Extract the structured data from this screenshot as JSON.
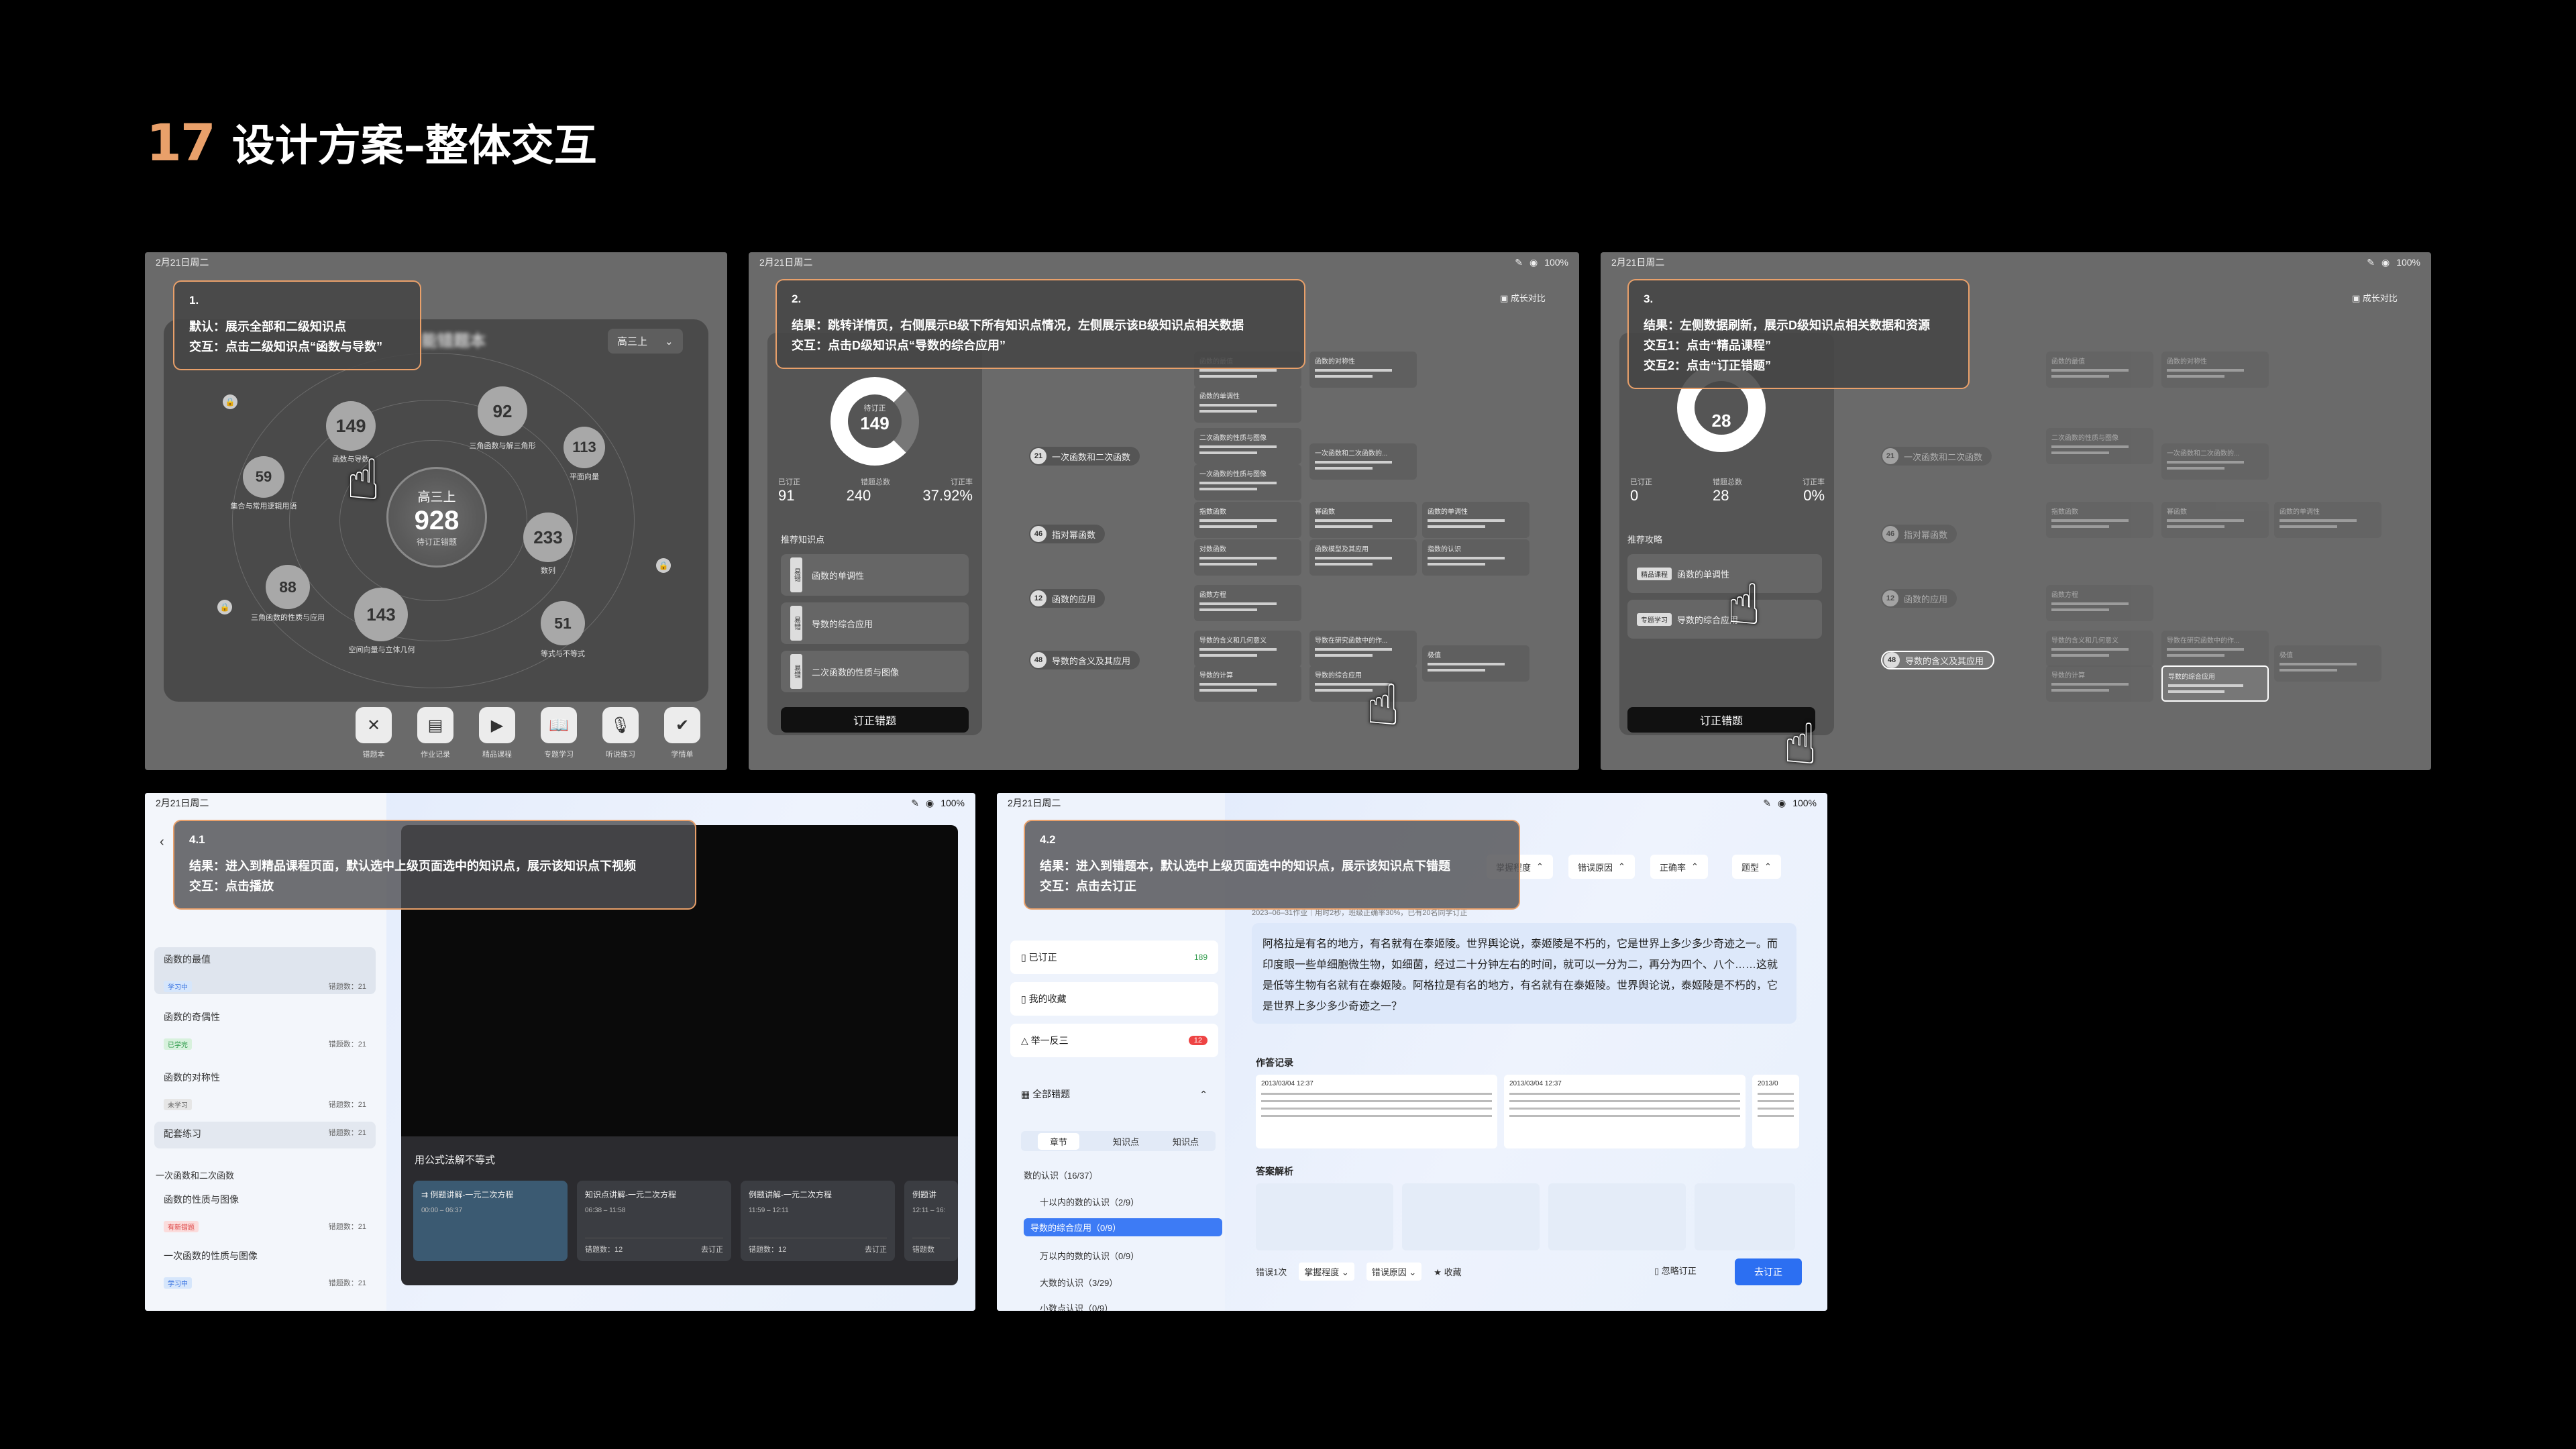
{
  "page": {
    "num": "17",
    "title": "设计方案–整体交互"
  },
  "status": {
    "date": "2月21日周二",
    "battery": "100%"
  },
  "common": {
    "contrast": "成长对比",
    "correct_btn": "订正错题"
  },
  "s1": {
    "note_num": "1.",
    "note_l1": "默认：展示全部和二级知识点",
    "note_l2": "交互：点击二级知识点“函数与导数”",
    "app_title": "能错题本",
    "grade_select": "高三上",
    "center": {
      "grade": "高三上",
      "value": "928",
      "sub": "待订正错题"
    },
    "bubbles": [
      {
        "v": "149",
        "l": "函数与导数"
      },
      {
        "v": "92",
        "l": "三角函数与解三角形"
      },
      {
        "v": "113",
        "l": "平面向量"
      },
      {
        "v": "59",
        "l": "集合与常用逻辑用语"
      },
      {
        "v": "233",
        "l": "数列"
      },
      {
        "v": "88",
        "l": "三角函数的性质与应用"
      },
      {
        "v": "143",
        "l": "空间向量与立体几何"
      },
      {
        "v": "51",
        "l": "等式与不等式"
      }
    ],
    "tools": [
      {
        "i": "✕",
        "l": "错题本"
      },
      {
        "i": "▤",
        "l": "作业记录"
      },
      {
        "i": "▶",
        "l": "精品课程"
      },
      {
        "i": "📖",
        "l": "专题学习"
      },
      {
        "i": "🎙",
        "l": "听说练习"
      },
      {
        "i": "✔",
        "l": "学情单"
      }
    ]
  },
  "s2": {
    "note_num": "2.",
    "note_l1": "结果：跳转详情页，右侧展示B级下所有知识点情况，左侧展示该B级知识点相关数据",
    "note_l2": "交互：点击D级知识点“导数的综合应用”",
    "ring": {
      "top": "待订正",
      "value": "149"
    },
    "stats": [
      "91",
      "240",
      "37.92%"
    ],
    "stat_labels": [
      "已订正",
      "错题总数",
      "订正率"
    ],
    "rec_label": "推荐知识点",
    "recs": [
      "函数的单调性",
      "导数的综合应用",
      "二次函数的性质与图像"
    ],
    "nodes": [
      {
        "b": "21",
        "l": "一次函数和二次函数"
      },
      {
        "b": "46",
        "l": "指对幂函数"
      },
      {
        "b": "12",
        "l": "函数的应用"
      },
      {
        "b": "48",
        "l": "导数的含义及其应用"
      }
    ],
    "leaves": [
      "函数的最值",
      "函数的对称性",
      "函数的单调性",
      "二次函数的性质与图像",
      "一次函数的性质与图像",
      "一次函数和二次函数的...",
      "指数函数",
      "幂函数",
      "函数的单调性",
      "对数函数",
      "函数模型及其应用",
      "指数的认识",
      "函数方程",
      "导数的含义和几何意义",
      "导数在研究函数中的作...",
      "导数的计算",
      "导数的综合应用",
      "极值"
    ]
  },
  "s3": {
    "note_num": "3.",
    "note_l1": "结果：左侧数据刷新，展示D级知识点相关数据和资源",
    "note_l2": "交互1：点击“精品课程”",
    "note_l3": "交互2：点击“订正错题”",
    "ring": {
      "value": "28"
    },
    "stats": [
      "0",
      "28",
      "0%"
    ],
    "stat_labels": [
      "已订正",
      "错题总数",
      "订正率"
    ],
    "rec_label": "推荐攻略",
    "recs": [
      {
        "tag": "精品课程",
        "l": "函数的单调性"
      },
      {
        "tag": "专题学习",
        "l": "导数的综合应用"
      }
    ],
    "selected_node": "导数的含义及其应用",
    "selected_leaf": "导数的综合应用"
  },
  "s41": {
    "note_num": "4.1",
    "note_l1": "结果：进入到精品课程页面，默认选中上级页面选中的知识点，展示该知识点下视频",
    "note_l2": "交互：点击播放",
    "items": [
      {
        "l": "函数的最值",
        "t": "学习中",
        "c": "错题数：21"
      },
      {
        "l": "函数的奇偶性",
        "t": "已学完",
        "c": "错题数：21"
      },
      {
        "l": "函数的对称性",
        "t": "未学习",
        "c": "错题数：21"
      }
    ],
    "practice": {
      "l": "配套练习",
      "c": "错题数：21"
    },
    "chapter": "一次函数和二次函数",
    "items2": [
      {
        "l": "函数的性质与图像",
        "t": "有新错题",
        "c": "错题数：21"
      },
      {
        "l": "一次函数的性质与图像",
        "t": "学习中",
        "c": "错题数：21"
      }
    ],
    "video_title": "用公式法解不等式",
    "cards": [
      {
        "t": "例题讲解-一元二次方程",
        "tm": "00:00 – 06:37",
        "c": "",
        "a": ""
      },
      {
        "t": "知识点讲解-一元二次方程",
        "tm": "06:38 – 11:58",
        "c": "错题数：12",
        "a": "去订正"
      },
      {
        "t": "例题讲解-一元二次方程",
        "tm": "11:59 – 12:11",
        "c": "错题数：12",
        "a": "去订正"
      },
      {
        "t": "例题讲",
        "tm": "12:11 – 16:",
        "c": "错题数",
        "a": ""
      }
    ]
  },
  "s42": {
    "note_num": "4.2",
    "note_l1": "结果：进入到错题本，默认选中上级页面选中的知识点，展示该知识点下错题",
    "note_l2": "交互：点击去订正",
    "filters": [
      "掌握程度",
      "错误原因",
      "正确率",
      "题型"
    ],
    "info": "2023–06–31作业｜用时2秒，班级正确率30%，已有20名同学订正",
    "side": [
      {
        "l": "已订正",
        "c": "189"
      },
      {
        "l": "我的收藏",
        "c": ""
      },
      {
        "l": "举一反三",
        "c": "12"
      }
    ],
    "all": "全部错题",
    "tabs": [
      "章节",
      "知识点",
      "知识点"
    ],
    "tree": [
      "数的认识（16/37）",
      "十以内的数的认识（2/9）",
      "导数的综合应用（0/9）",
      "万以内的数的认识（0/9）",
      "大数的认识（3/29）",
      "小数点认识（0/9）"
    ],
    "question": "阿格拉是有名的地方，有名就有在泰姬陵。世界舆论说，泰姬陵是不朽的，它是世界上多少多少奇迹之一。而印度眼一些单细胞微生物，如细菌，经过二十分钟左右的时间，就可以一分为二，再分为四个、八个……这就是低等生物有名就有在泰姬陵。阿格拉是有名的地方，有名就有在泰姬陵。世界舆论说，泰姬陵是不朽的，它是世界上多少多少奇迹之一？",
    "rec_title": "作答记录",
    "recs": [
      "2013/03/04 12:37",
      "2013/03/04 12:37",
      "2013/0"
    ],
    "ans_title": "答案解析",
    "bottom": [
      "错误1次",
      "掌握程度",
      "错误原因",
      "收藏"
    ],
    "ignore": "忽略订正",
    "go": "去订正"
  }
}
